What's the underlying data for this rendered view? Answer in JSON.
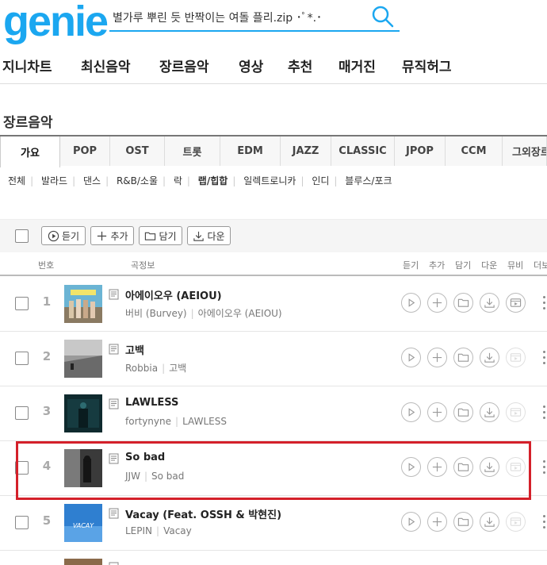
{
  "header": {
    "logo_text": "genie",
    "search_value": "별가루 뿌린 듯 반짝이는 여돌 플리.zip ･ﾟ*.･",
    "brand_color": "#1ba7f0"
  },
  "nav": [
    "지니차트",
    "최신음악",
    "장르음악",
    "영상",
    "추천",
    "매거진",
    "뮤직허그"
  ],
  "section_title": "장르음악",
  "genre_tabs": [
    "가요",
    "POP",
    "OST",
    "트롯",
    "EDM",
    "JAZZ",
    "CLASSIC",
    "JPOP",
    "CCM",
    "그외장르"
  ],
  "active_tab": "가요",
  "subgenres": [
    "전체",
    "발라드",
    "댄스",
    "R&B/소울",
    "락",
    "랩/힙합",
    "일렉트로니카",
    "인디",
    "블루스/포크"
  ],
  "active_subgenre": "랩/힙합",
  "toolbar": {
    "listen": "듣기",
    "add": "추가",
    "save": "담기",
    "download": "다운"
  },
  "table_headers": {
    "num": "번호",
    "info": "곡정보",
    "listen": "듣기",
    "add": "추가",
    "save": "담기",
    "download": "다운",
    "video": "뮤비",
    "more": "더보기"
  },
  "songs": [
    {
      "rank": "1",
      "title": "아에이오우 (AEIOU)",
      "artist": "버비 (Burvey)",
      "album": "아에이오우 (AEIOU)",
      "has_video": true
    },
    {
      "rank": "2",
      "title": "고백",
      "artist": "Robbia",
      "album": "고백",
      "has_video": false
    },
    {
      "rank": "3",
      "title": "LAWLESS",
      "artist": "fortynyne",
      "album": "LAWLESS",
      "has_video": false
    },
    {
      "rank": "4",
      "title": "So bad",
      "artist": "JJW",
      "album": "So bad",
      "has_video": false
    },
    {
      "rank": "5",
      "title": "Vacay (Feat. OSSH & 박현진)",
      "artist": "LEPIN",
      "album": "Vacay",
      "has_video": false
    }
  ],
  "highlight_color": "#d4202a"
}
